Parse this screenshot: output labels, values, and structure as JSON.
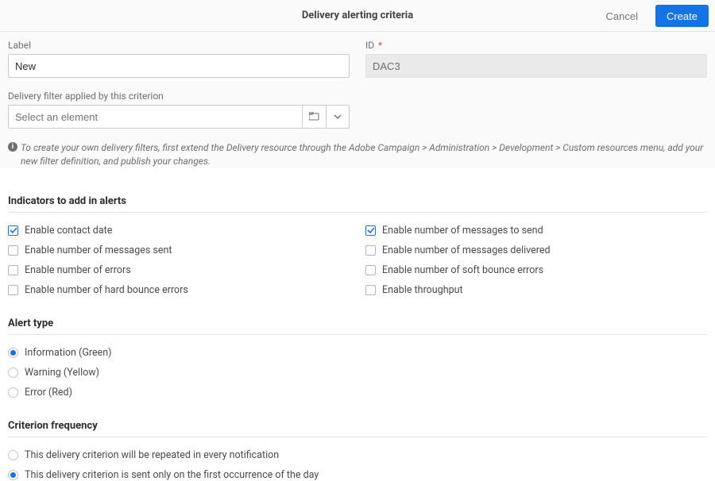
{
  "header": {
    "title": "Delivery alerting criteria",
    "cancel": "Cancel",
    "create": "Create"
  },
  "form": {
    "label_field": {
      "label": "Label",
      "value": "New"
    },
    "id_field": {
      "label": "ID",
      "value": "DAC3",
      "required_mark": "*"
    },
    "filter_field": {
      "label": "Delivery filter applied by this criterion",
      "placeholder": "Select an element"
    },
    "hint": "To create your own delivery filters, first extend the Delivery resource through the Adobe Campaign > Administration > Development > Custom resources menu, add your new filter definition, and publish your changes."
  },
  "indicators": {
    "heading": "Indicators to add in alerts",
    "left": [
      {
        "label": "Enable contact date",
        "checked": true
      },
      {
        "label": "Enable number of messages sent",
        "checked": false
      },
      {
        "label": "Enable number of errors",
        "checked": false
      },
      {
        "label": "Enable number of hard bounce errors",
        "checked": false
      }
    ],
    "right": [
      {
        "label": "Enable number of messages to send",
        "checked": true
      },
      {
        "label": "Enable number of messages delivered",
        "checked": false
      },
      {
        "label": "Enable number of soft bounce errors",
        "checked": false
      },
      {
        "label": "Enable throughput",
        "checked": false
      }
    ]
  },
  "alert_type": {
    "heading": "Alert type",
    "options": [
      {
        "label": "Information (Green)",
        "selected": true
      },
      {
        "label": "Warning (Yellow)",
        "selected": false
      },
      {
        "label": "Error (Red)",
        "selected": false
      }
    ]
  },
  "frequency": {
    "heading": "Criterion frequency",
    "options": [
      {
        "label": "This delivery criterion will be repeated in every notification",
        "selected": false
      },
      {
        "label": "This delivery criterion is sent only on the first occurrence of the day",
        "selected": true
      }
    ]
  }
}
